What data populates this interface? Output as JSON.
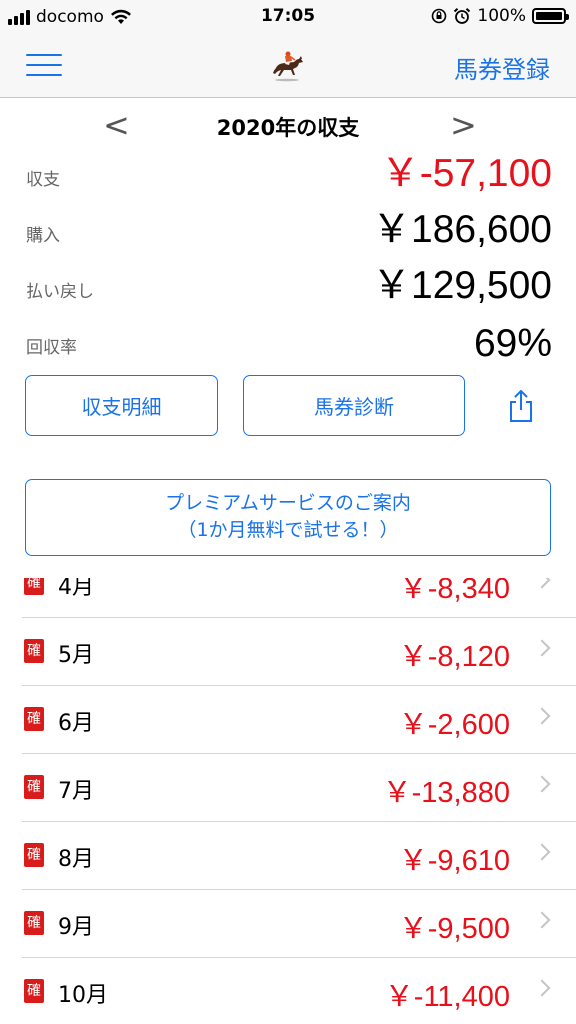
{
  "status_bar": {
    "carrier": "docomo",
    "time": "17:05",
    "battery": "100%"
  },
  "nav": {
    "logo_icon": "horse-jockey-icon",
    "action_label": "馬券登録"
  },
  "year_selector": {
    "title": "2020年の収支",
    "prev": "<",
    "next": ">"
  },
  "summary": {
    "balance_label": "収支",
    "balance_value": "￥-57,100",
    "purchase_label": "購入",
    "purchase_value": "￥186,600",
    "payout_label": "払い戻し",
    "payout_value": "￥129,500",
    "return_rate_label": "回収率",
    "return_rate_value": "69%"
  },
  "buttons": {
    "details": "収支明細",
    "diagnosis": "馬券診断",
    "share_icon": "share-icon"
  },
  "premium": {
    "line1": "プレミアムサービスのご案内",
    "line2": "（1か月無料で試せる！）"
  },
  "months": [
    {
      "badge": "確",
      "month": "4月",
      "amount": "￥-8,340"
    },
    {
      "badge": "確",
      "month": "5月",
      "amount": "￥-8,120"
    },
    {
      "badge": "確",
      "month": "6月",
      "amount": "￥-2,600"
    },
    {
      "badge": "確",
      "month": "7月",
      "amount": "￥-13,880"
    },
    {
      "badge": "確",
      "month": "8月",
      "amount": "￥-9,610"
    },
    {
      "badge": "確",
      "month": "9月",
      "amount": "￥-9,500"
    },
    {
      "badge": "確",
      "month": "10月",
      "amount": "￥-11,400"
    }
  ],
  "colors": {
    "accent": "#1a73e8",
    "negative": "#e8101a",
    "badge": "#d81b1b"
  }
}
